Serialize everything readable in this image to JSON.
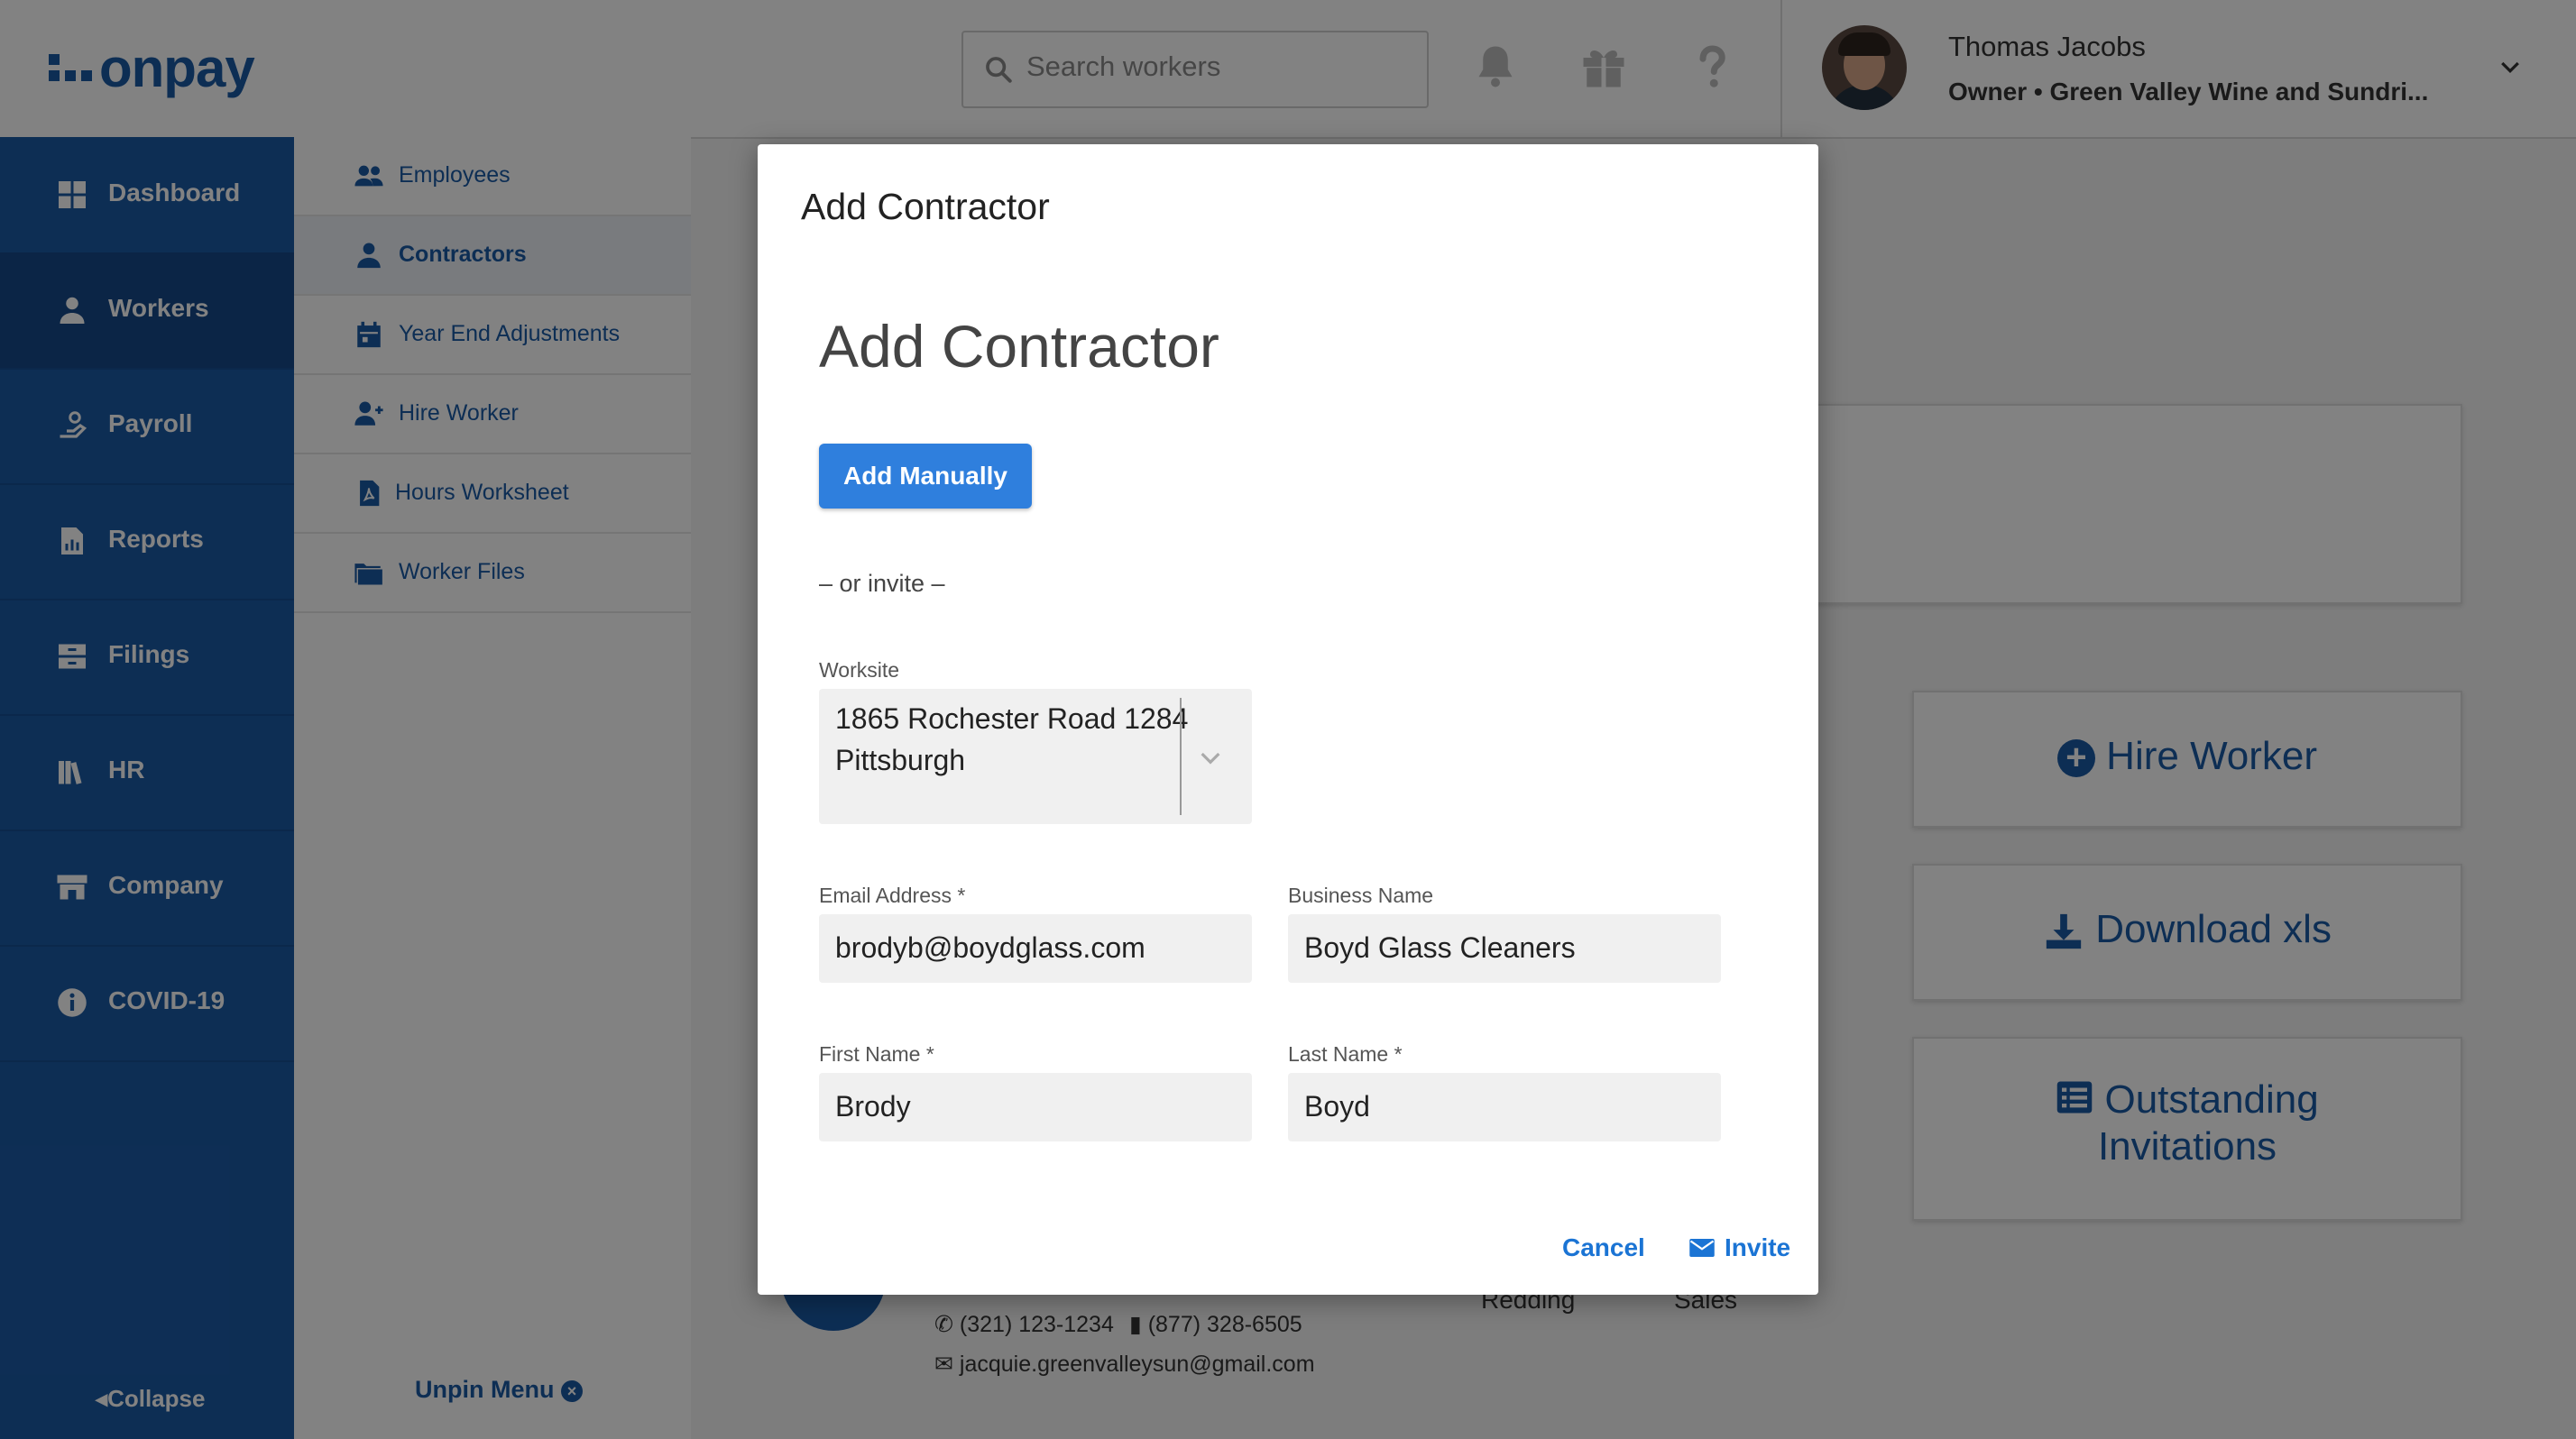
{
  "header": {
    "logo": "onpay",
    "search_placeholder": "Search workers",
    "icons": [
      "bell-icon",
      "gift-icon",
      "question-icon"
    ],
    "user_name": "Thomas Jacobs",
    "user_subtitle": "Owner • Green Valley Wine and Sundri..."
  },
  "sidebar": {
    "items": [
      {
        "label": "Dashboard",
        "icon": "dashboard-icon"
      },
      {
        "label": "Workers",
        "icon": "workers-icon"
      },
      {
        "label": "Payroll",
        "icon": "payroll-icon"
      },
      {
        "label": "Reports",
        "icon": "reports-icon"
      },
      {
        "label": "Filings",
        "icon": "filings-icon"
      },
      {
        "label": "HR",
        "icon": "hr-icon"
      },
      {
        "label": "Company",
        "icon": "company-icon"
      },
      {
        "label": "COVID-19",
        "icon": "info-icon"
      }
    ],
    "active": "Workers",
    "collapse_label": "Collapse"
  },
  "subnav": {
    "items": [
      {
        "label": "Employees",
        "icon": "employees-icon"
      },
      {
        "label": "Contractors",
        "icon": "contractor-icon"
      },
      {
        "label": "Year End Adjustments",
        "icon": "calendar-icon"
      },
      {
        "label": "Hire Worker",
        "icon": "add-user-icon"
      },
      {
        "label": "Hours Worksheet",
        "icon": "pdf-icon"
      },
      {
        "label": "Worker Files",
        "icon": "folder-icon"
      }
    ],
    "active": "Contractors",
    "unpin_label": "Unpin Menu"
  },
  "background": {
    "actions": [
      "Hire Worker",
      "Download xls",
      "Outstanding Invitations"
    ],
    "contact": {
      "phone": "(321) 123-1234",
      "mobile": "(877) 328-6505",
      "email": "jacquie.greenvalleysun@gmail.com",
      "location": "Redding",
      "department": "Sales"
    }
  },
  "modal": {
    "title": "Add Contractor",
    "heading": "Add Contractor",
    "add_manually_label": "Add Manually",
    "or_invite": "– or invite –",
    "worksite": {
      "label": "Worksite",
      "value_line1": "1865 Rochester Road 1284",
      "value_line2": "Pittsburgh"
    },
    "email": {
      "label": "Email Address *",
      "value": "brodyb@boydglass.com"
    },
    "business": {
      "label": "Business Name",
      "value": "Boyd Glass Cleaners"
    },
    "first_name": {
      "label": "First Name *",
      "value": "Brody"
    },
    "last_name": {
      "label": "Last Name *",
      "value": "Boyd"
    },
    "cancel_label": "Cancel",
    "invite_label": "Invite"
  },
  "colors": {
    "brand": "#1b5aa6",
    "primary_button": "#2f7fdd",
    "link": "#1b74d4"
  }
}
